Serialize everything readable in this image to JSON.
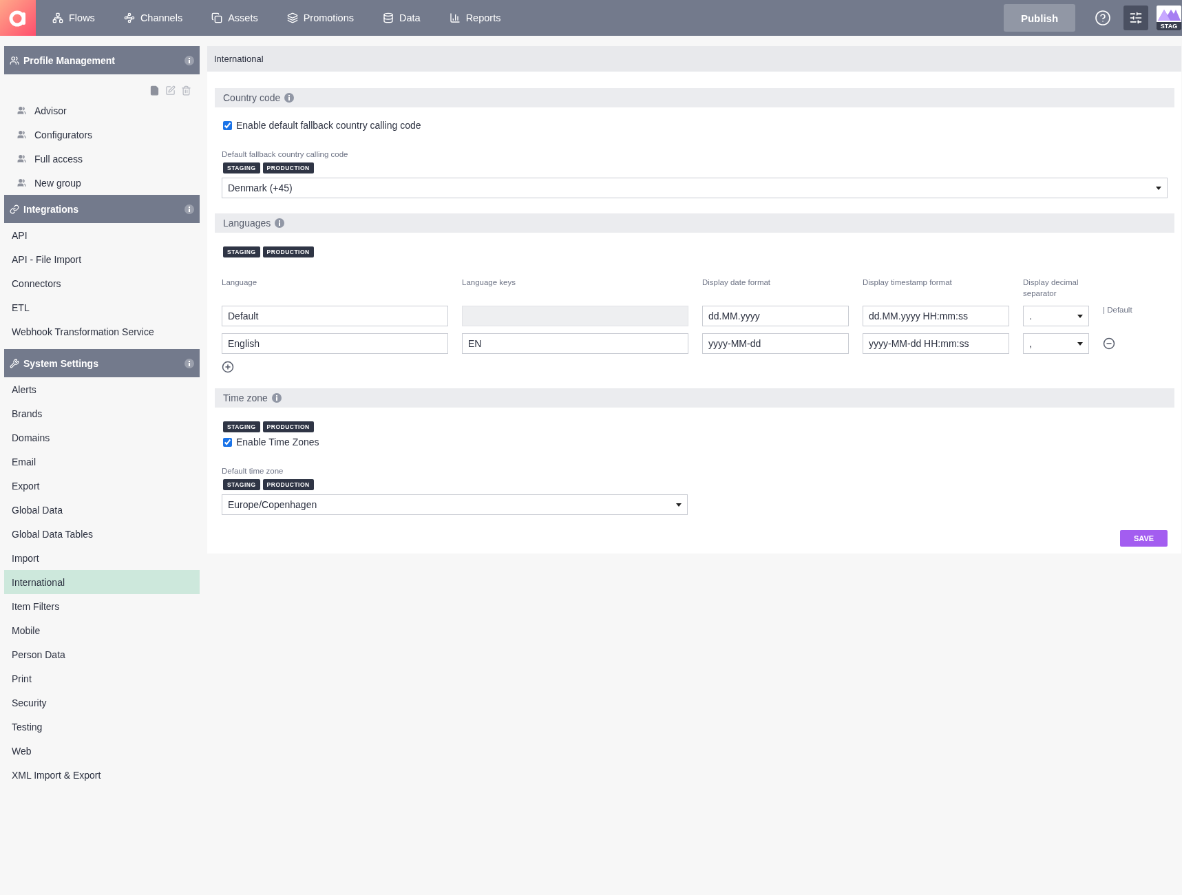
{
  "topbar": {
    "nav": [
      {
        "label": "Flows",
        "kind": "flows"
      },
      {
        "label": "Channels",
        "kind": "channels"
      },
      {
        "label": "Assets",
        "kind": "assets"
      },
      {
        "label": "Promotions",
        "kind": "promotions"
      },
      {
        "label": "Data",
        "kind": "data"
      },
      {
        "label": "Reports",
        "kind": "reports"
      }
    ],
    "publish": "Publish",
    "environment": "STAG"
  },
  "sidebar": {
    "sections": [
      {
        "title": "Profile Management",
        "kind": "profiles",
        "items": [
          {
            "label": "Advisor",
            "selected": false
          },
          {
            "label": "Configurators",
            "selected": false
          },
          {
            "label": "Full access",
            "selected": false
          },
          {
            "label": "New group",
            "selected": false
          }
        ]
      },
      {
        "title": "Integrations",
        "kind": "integrations",
        "items": [
          {
            "label": "API",
            "selected": false
          },
          {
            "label": "API - File Import",
            "selected": false
          },
          {
            "label": "Connectors",
            "selected": false
          },
          {
            "label": "ETL",
            "selected": false
          },
          {
            "label": "Webhook Transformation Service",
            "selected": false
          }
        ]
      },
      {
        "title": "System Settings",
        "kind": "settings",
        "items": [
          {
            "label": "Alerts",
            "selected": false
          },
          {
            "label": "Brands",
            "selected": false
          },
          {
            "label": "Domains",
            "selected": false
          },
          {
            "label": "Email",
            "selected": false
          },
          {
            "label": "Export",
            "selected": false
          },
          {
            "label": "Global Data",
            "selected": false
          },
          {
            "label": "Global Data Tables",
            "selected": false
          },
          {
            "label": "Import",
            "selected": false
          },
          {
            "label": "International",
            "selected": true
          },
          {
            "label": "Item Filters",
            "selected": false
          },
          {
            "label": "Mobile",
            "selected": false
          },
          {
            "label": "Person Data",
            "selected": false
          },
          {
            "label": "Print",
            "selected": false
          },
          {
            "label": "Security",
            "selected": false
          },
          {
            "label": "Testing",
            "selected": false
          },
          {
            "label": "Web",
            "selected": false
          },
          {
            "label": "XML Import & Export",
            "selected": false
          }
        ]
      }
    ]
  },
  "page": {
    "title": "International",
    "country_code": {
      "title": "Country code",
      "checkbox": {
        "label": "Enable default fallback country calling code",
        "checked": true
      },
      "field_label": "Default fallback country calling code",
      "badges": [
        "STAGING",
        "PRODUCTION"
      ],
      "value": "Denmark (+45)"
    },
    "languages": {
      "title": "Languages",
      "badges": [
        "STAGING",
        "PRODUCTION"
      ],
      "columns": [
        "Language",
        "Language keys",
        "Display date format",
        "Display timestamp format",
        "Display decimal separator"
      ],
      "rows": [
        {
          "kind": "default",
          "language": "Default",
          "keys": "",
          "keys_disabled": true,
          "date_format": "dd.MM.yyyy",
          "timestamp_format": "dd.MM.yyyy HH:mm:ss",
          "separator": ".",
          "note": "| Default"
        },
        {
          "kind": "removable",
          "language": "English",
          "keys": "EN",
          "keys_disabled": false,
          "date_format": "yyyy-MM-dd",
          "timestamp_format": "yyyy-MM-dd HH:mm:ss",
          "separator": ","
        }
      ]
    },
    "time_zone": {
      "title": "Time zone",
      "badges": [
        "STAGING",
        "PRODUCTION"
      ],
      "checkbox": {
        "label": "Enable Time Zones",
        "checked": true
      },
      "field_label": "Default time zone",
      "field_badges": [
        "STAGING",
        "PRODUCTION"
      ],
      "value": "Europe/Copenhagen"
    },
    "save": "SAVE"
  }
}
